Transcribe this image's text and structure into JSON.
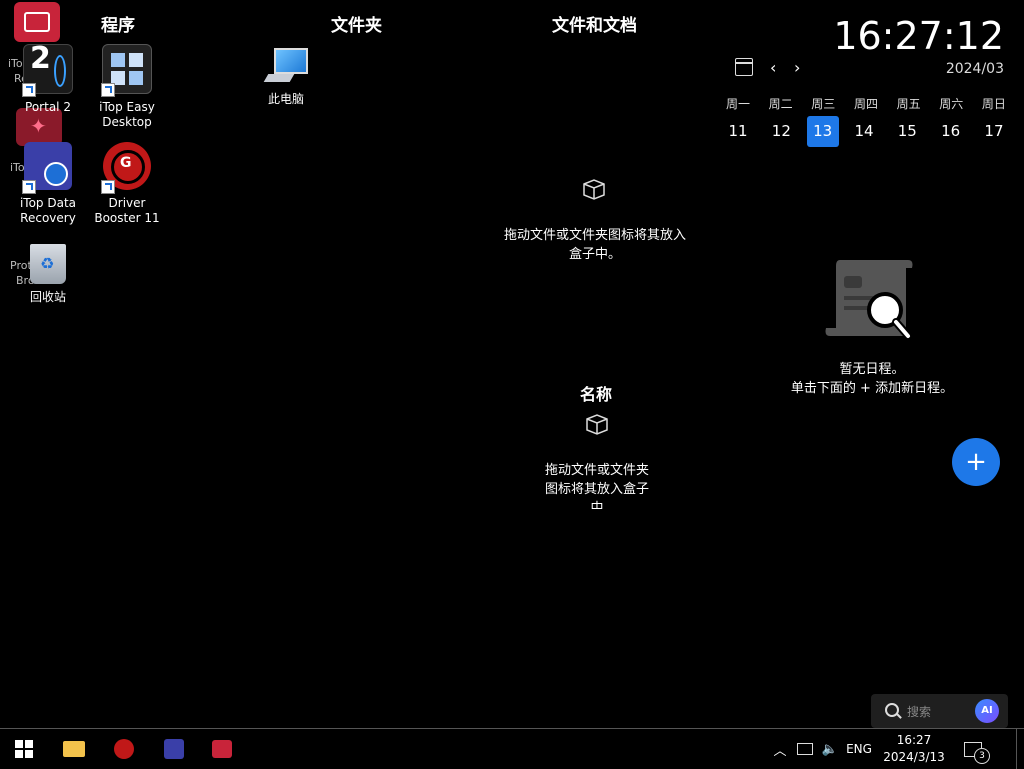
{
  "desktop": {
    "partial_labels": [
      "iTop",
      "Re",
      "iTo",
      "Prot",
      "Brow"
    ],
    "icons": [
      {
        "label": "Portal 2",
        "icon": "portal2-icon"
      },
      {
        "label": "iTop Data Recovery",
        "icon": "itop-data-recovery-icon"
      },
      {
        "label": "回收站",
        "icon": "recycle-bin-icon"
      },
      {
        "label": "iTop Easy Desktop",
        "icon": "itop-easy-desktop-icon"
      },
      {
        "label": "Driver Booster 11",
        "icon": "driver-booster-icon"
      },
      {
        "label": "此电脑",
        "icon": "this-pc-icon"
      }
    ]
  },
  "boxes": {
    "programs_title": "程序",
    "folders_title": "文件夹",
    "files_title": "文件和文档",
    "files_hint_line1": "拖动文件或文件夹图标将其放入",
    "files_hint_line2": "盒子中。",
    "name_title": "名称",
    "name_hint_line1": "拖动文件或文件夹",
    "name_hint_line2": "图标将其放入盒子",
    "name_hint_line3": "中"
  },
  "calendar": {
    "time": "16:27:12",
    "month": "2024/03",
    "weekdays": [
      "周一",
      "周二",
      "周三",
      "周四",
      "周五",
      "周六",
      "周日"
    ],
    "days": [
      "11",
      "12",
      "13",
      "14",
      "15",
      "16",
      "17"
    ],
    "today": "13",
    "empty_line1": "暂无日程。",
    "empty_line2": "单击下面的 + 添加新日程。",
    "add_label": "+"
  },
  "search": {
    "placeholder": "搜索",
    "ai_label": "AI"
  },
  "taskbar": {
    "lang": "ENG",
    "time": "16:27",
    "date": "2024/3/13",
    "notifications": "3"
  },
  "colors": {
    "accent": "#1e78e8",
    "background": "#000000"
  }
}
